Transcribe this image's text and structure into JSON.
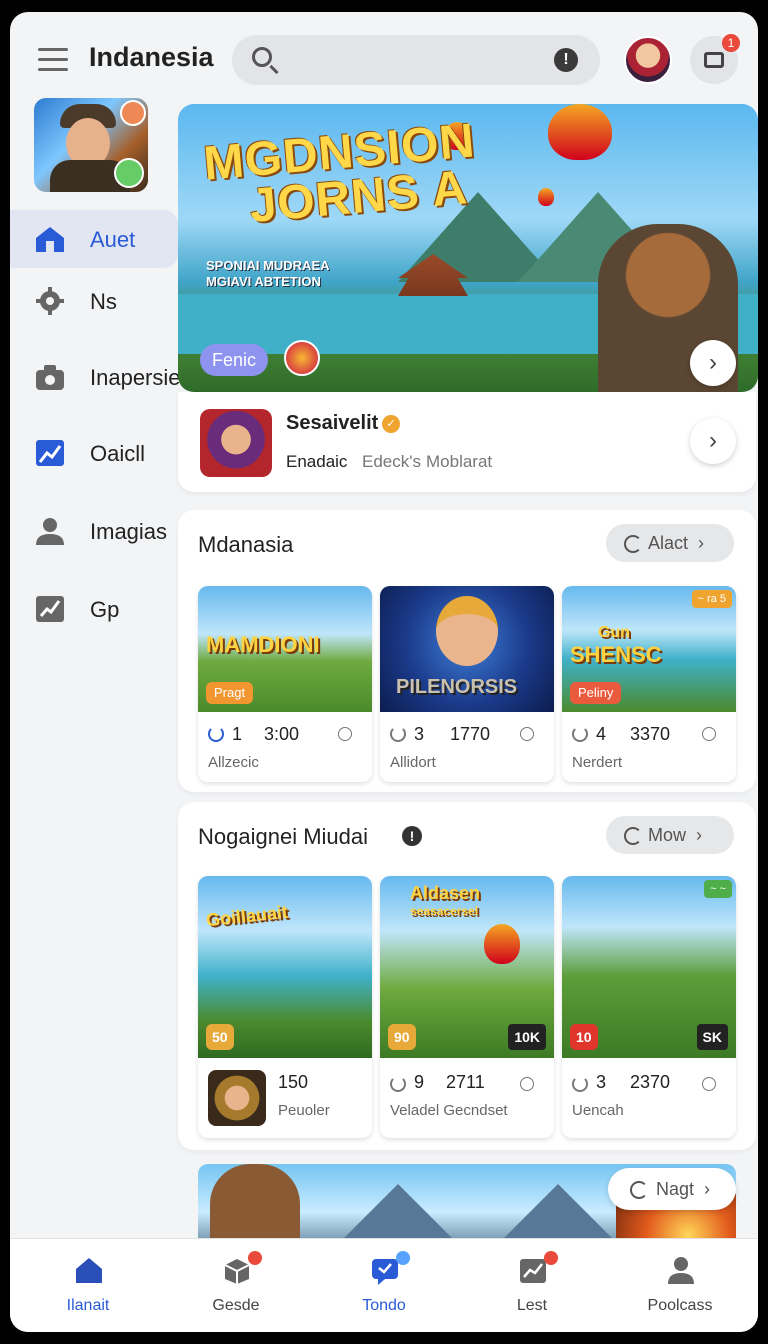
{
  "header": {
    "app_title": "Indanesia",
    "search_placeholder": "",
    "store_badge": "1"
  },
  "sidebar": {
    "items": [
      {
        "label": "Auet",
        "icon": "home-icon",
        "active": true
      },
      {
        "label": "Ns",
        "icon": "gear-icon"
      },
      {
        "label": "Inapersie",
        "icon": "camera-icon"
      },
      {
        "label": "Oaicll",
        "icon": "chart-icon"
      },
      {
        "label": "Imagias",
        "icon": "person-icon"
      },
      {
        "label": "Gp",
        "icon": "graph-icon"
      }
    ]
  },
  "hero": {
    "title_line1": "MGDNSION",
    "title_line2": "JORNS A",
    "subtitle_line1": "SPONIAI MUDRAEA",
    "subtitle_line2": "MGIAVI ABTETION",
    "chip": "Fenic",
    "next": "›"
  },
  "featured": {
    "title": "Sesaivelit",
    "sub1": "Enadaic",
    "sub2": "Edeck's",
    "sub3": "Moblarat",
    "next": "›"
  },
  "section1": {
    "title": "Mdanasia",
    "button": "Alact",
    "cards": [
      {
        "art": "MAMDIONI",
        "chip": "Pragt",
        "n1": "1",
        "n2": "3:00",
        "meta": "Allzecic"
      },
      {
        "art": "PILENORSIS",
        "n1": "3",
        "n2": "1770",
        "meta": "Allidort"
      },
      {
        "art_line1": "Gun",
        "art_line2": "SHENSC",
        "chip": "Peliny",
        "tag": "~ ra 5",
        "n1": "4",
        "n2": "3370",
        "meta": "Nerdert"
      }
    ]
  },
  "section2": {
    "title": "Nogaignei Miudai",
    "button": "Mow",
    "cards": [
      {
        "art": "Goillauait",
        "count": "50",
        "n1": "150",
        "meta": "Peuoler"
      },
      {
        "art_line1": "Aldasen",
        "art_line2": "seasacersel",
        "count": "90",
        "right_count": "10K",
        "n1": "9",
        "n2": "2711",
        "meta": "Veladel Gecndset"
      },
      {
        "count": "10",
        "right_count": "SK",
        "n1": "3",
        "n2": "2370",
        "meta": "Uencah"
      }
    ]
  },
  "promo": {
    "button": "Nagt"
  },
  "bottom_nav": {
    "tabs": [
      {
        "label": "Ilanait",
        "icon": "home-icon",
        "active": true
      },
      {
        "label": "Gesde",
        "icon": "box-icon"
      },
      {
        "label": "Tondo",
        "icon": "chat-icon"
      },
      {
        "label": "Lest",
        "icon": "chart-icon"
      },
      {
        "label": "Poolcass",
        "icon": "person-icon"
      }
    ]
  },
  "colors": {
    "accent": "#2a5bd7",
    "badge": "#e94a3c",
    "chip_purple": "#8f93f0",
    "background": "#f3f4f6"
  }
}
